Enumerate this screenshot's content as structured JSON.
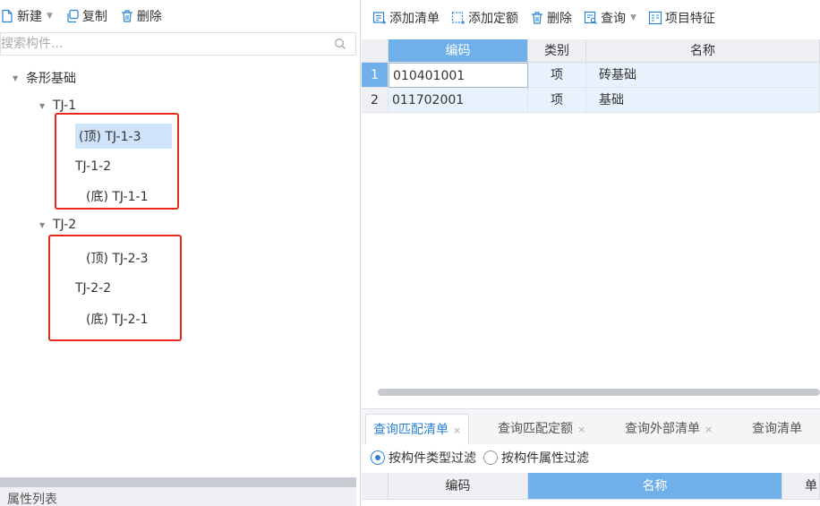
{
  "left": {
    "toolbar": {
      "new_label": "新建",
      "copy_label": "复制",
      "delete_label": "删除"
    },
    "search": {
      "placeholder": "搜索构件..."
    },
    "tree": {
      "root": "条形基础",
      "groups": [
        {
          "label": "TJ-1",
          "children": [
            "(顶) TJ-1-3",
            "TJ-1-2",
            "(底) TJ-1-1"
          ]
        },
        {
          "label": "TJ-2",
          "children": [
            "(顶) TJ-2-3",
            "TJ-2-2",
            "(底) TJ-2-1"
          ]
        }
      ]
    },
    "properties_title": "属性列表"
  },
  "right": {
    "toolbar": {
      "add_list_label": "添加清单",
      "add_quota_label": "添加定额",
      "delete_label": "删除",
      "query_label": "查询",
      "item_feature_label": "项目特征"
    },
    "grid": {
      "headers": [
        "编码",
        "类别",
        "名称"
      ],
      "rows": [
        {
          "num": "1",
          "code": "010401001",
          "type": "项",
          "name": "砖基础"
        },
        {
          "num": "2",
          "code": "011702001",
          "type": "项",
          "name": "基础"
        }
      ]
    },
    "tabs": [
      "查询匹配清单",
      "查询匹配定额",
      "查询外部清单",
      "查询清单"
    ],
    "filters": [
      "按构件类型过滤",
      "按构件属性过滤"
    ],
    "bottom_grid": {
      "headers": [
        "编码",
        "名称",
        "单"
      ]
    }
  },
  "colors": {
    "accent": "#2b83d6",
    "header_active": "#6fb0ea",
    "selection": "#cfe3fb",
    "highlight_box": "#e8271e"
  }
}
